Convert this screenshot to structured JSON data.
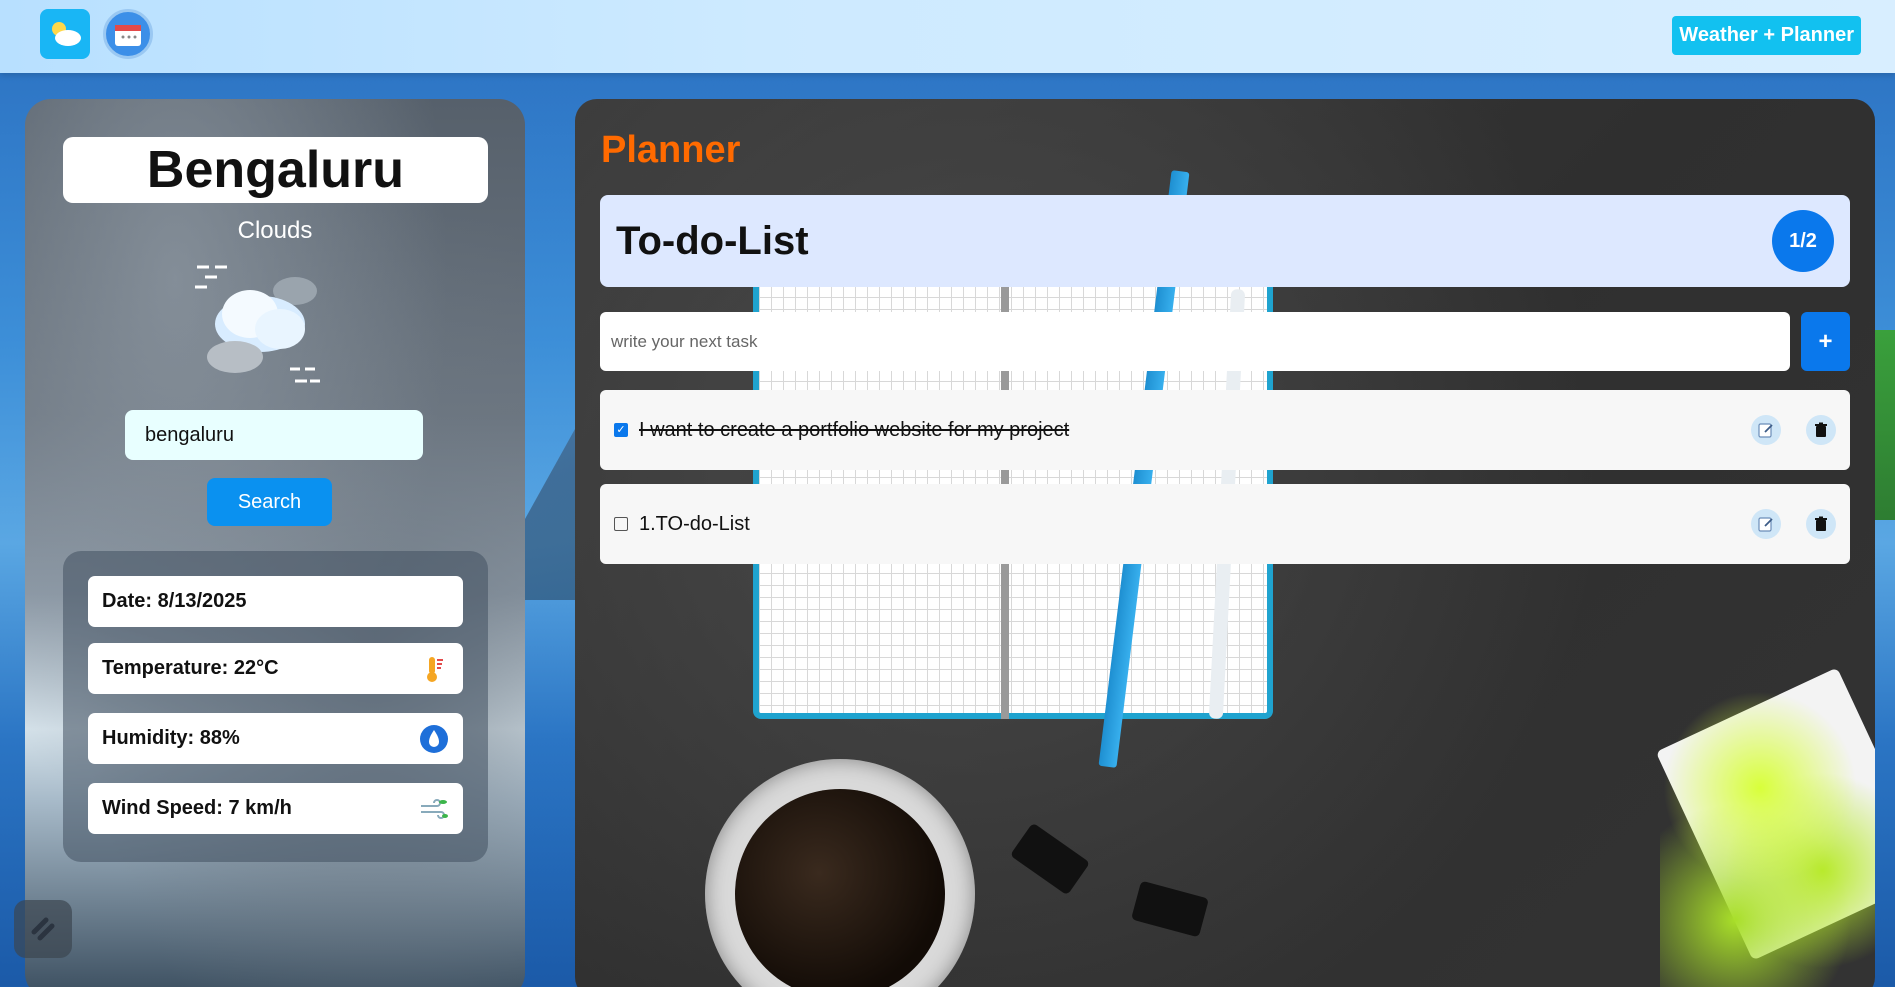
{
  "header": {
    "weather_icon": "weather-app-icon",
    "planner_icon": "planner-app-icon",
    "brand_label": "Weather + Planner"
  },
  "weather": {
    "city": "Bengaluru",
    "condition": "Clouds",
    "search_value": "bengaluru",
    "search_button": "Search",
    "stats": {
      "date": "Date: 8/13/2025",
      "temperature": "Temperature: 22°C",
      "humidity": "Humidity: 88%",
      "wind": "Wind Speed: 7 km/h"
    }
  },
  "planner": {
    "title": "Planner",
    "list_title": "To-do-List",
    "count": "1/2",
    "input_placeholder": "write your next task",
    "add_label": "+",
    "tasks": [
      {
        "text": "I want to create a portfolio website for my project",
        "done": true
      },
      {
        "text": "1.TO-do-List",
        "done": false
      }
    ]
  },
  "colors": {
    "accent_blue": "#0a78ec",
    "planner_orange": "#ff6a00",
    "brand_cyan": "#12c1f0"
  }
}
